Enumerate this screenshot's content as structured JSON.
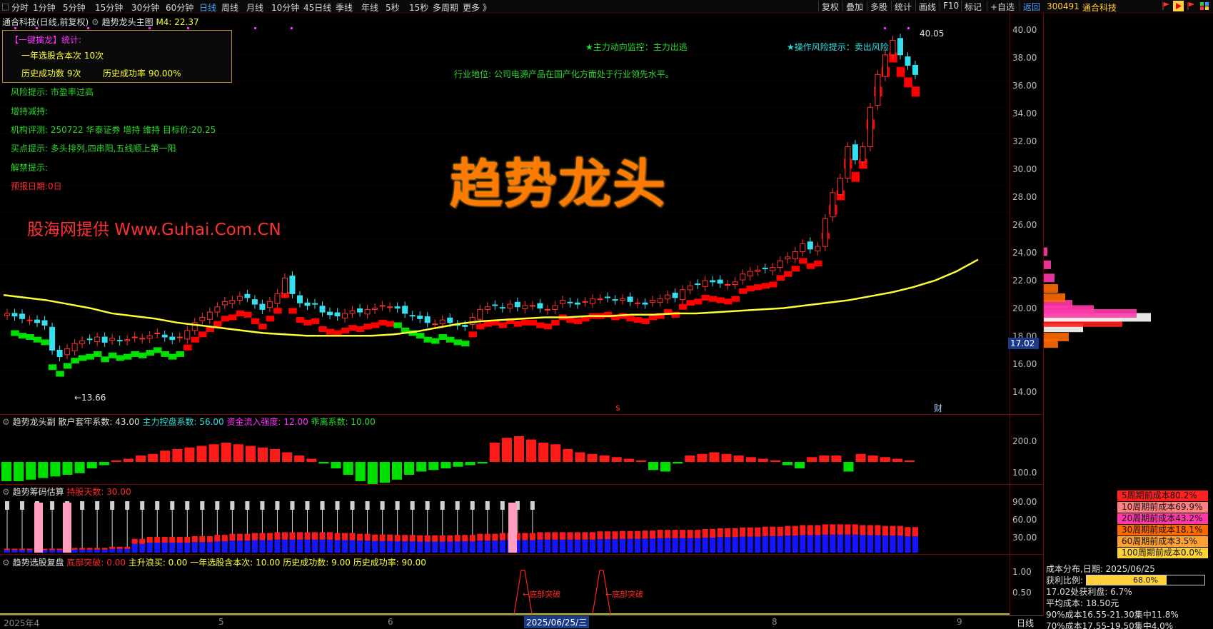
{
  "toolbar": {
    "left": [
      "分时",
      "1分钟",
      "5分钟",
      "15分钟",
      "30分钟",
      "60分钟",
      "日线",
      "周线",
      "月线",
      "10分钟",
      "45日线",
      "季线",
      "年线",
      "5秒",
      "15秒",
      "多周期",
      "更多 》"
    ],
    "active": "日线",
    "right": [
      "复权",
      "叠加",
      "多股",
      "统计",
      "画线",
      "F10",
      "标记",
      "+自选",
      "返回"
    ]
  },
  "stock": {
    "code": "300491",
    "name": "通合科技"
  },
  "main_panel": {
    "title": "通合科技(日线,前复权)",
    "indicator": "趋势龙头主图",
    "m4": "M4: 22.37",
    "big_title": "趋势龙头",
    "watermark": "股海网提供 Www.Guhai.Com.CN",
    "monitor1": "★主力动向监控：主力出逃",
    "monitor2": "★操作风险提示：卖出风险",
    "industry": "行业地位: 公司电源产品在国产化方面处于行业领先水平。",
    "high_label": "40.05",
    "low_label": "←13.66",
    "last_price": "17.02",
    "marker_s": "$",
    "marker_cai": "财"
  },
  "infobox": {
    "title": "【一键擒龙】统计:",
    "line1": "一年选股含本次 10次",
    "line2a": "历史成功数 9次",
    "line2b": "历史成功率 90.00%"
  },
  "notes": [
    {
      "label": "风险提示:",
      "value": "市盈率过高"
    },
    {
      "label": "增持减持:",
      "value": ""
    },
    {
      "label": "机构评测:",
      "value": "250722 华泰证券 增持 维持 目标价:20.25"
    },
    {
      "label": "买点提示:",
      "value": "多头排列,四串阳,五线顺上第一阳"
    },
    {
      "label": "解禁提示:",
      "value": ""
    },
    {
      "label": "预报日期:0日",
      "value": ""
    }
  ],
  "price_axis": [
    "40.00",
    "38.00",
    "36.00",
    "34.00",
    "32.00",
    "30.00",
    "28.00",
    "26.00",
    "24.00",
    "22.00",
    "20.00",
    "18.00",
    "16.00",
    "14.00"
  ],
  "sub1": {
    "title": "趋势龙头副",
    "f1": "散户套牢系数: 43.00",
    "f2": "主力控盘系数: 56.00",
    "f3": "资金流入强度: 12.00",
    "f4": "乖离系数: 10.00",
    "axis": [
      "200.0",
      "100.0"
    ]
  },
  "sub2": {
    "title": "趋势筹码估算",
    "f1": "持股天数: 30.00",
    "axis": [
      "90.00",
      "60.00",
      "30.00"
    ]
  },
  "sub3": {
    "title": "趋势选股复盘",
    "f1": "底部突破: 0.00",
    "f2": "主升浪买: 0.00",
    "f3": "一年选股含本次: 10.00",
    "f4": "历史成功数: 9.00",
    "f5": "历史成功率: 90.00",
    "axis": [
      "1.00",
      "0.50"
    ],
    "ann1": "←底部突破",
    "ann2": "←底部突破"
  },
  "time_axis": {
    "labels": [
      "2025年4",
      "5",
      "6",
      "8",
      "9"
    ],
    "cursor": "2025/06/25/三",
    "period": "日线"
  },
  "cost_table": [
    {
      "label": "5周期前成本80.2%",
      "color": "#ff2020"
    },
    {
      "label": "10周期前成本69.9%",
      "color": "#ff8080"
    },
    {
      "label": "20周期前成本43.2%",
      "color": "#ff3aa8"
    },
    {
      "label": "30周期前成本18.1%",
      "color": "#ff6a00"
    },
    {
      "label": "60周期前成本3.5%",
      "color": "#ffa030"
    },
    {
      "label": "100周期前成本0.0%",
      "color": "#ffd23a"
    }
  ],
  "chip_info": {
    "date": "成本分布,日期: 2025/06/25",
    "profit_label": "获利比例:",
    "profit_value": "68.0%",
    "profit_fraction": 0.68,
    "at_price": "17.02处获利盘: 6.7%",
    "avg": "平均成本: 18.50元",
    "c90": "90%成本16.55-21.30集中11.8%",
    "c70": "70%成本17.55-19.50集中4.0%"
  },
  "chart_data": {
    "type": "candlestick",
    "period": "daily",
    "date_range": [
      "2025-04",
      "2025-09"
    ],
    "ylim": [
      13,
      41
    ],
    "high": 40.05,
    "low": 13.66,
    "last": 17.02,
    "close_series": [
      18.3,
      18.1,
      17.9,
      17.8,
      17.6,
      17.4,
      15.5,
      15.0,
      15.6,
      16.0,
      16.2,
      16.3,
      16.5,
      16.1,
      16.4,
      16.2,
      16.3,
      16.5,
      16.4,
      16.6,
      16.8,
      16.5,
      16.3,
      16.5,
      17.0,
      17.6,
      18.0,
      18.4,
      18.8,
      19.2,
      19.3,
      19.6,
      19.5,
      19.0,
      18.6,
      19.2,
      19.8,
      21.0,
      19.8,
      19.1,
      18.9,
      19.0,
      18.4,
      18.2,
      18.1,
      18.3,
      18.5,
      18.4,
      18.6,
      18.7,
      18.9,
      18.8,
      18.7,
      18.3,
      18.1,
      17.9,
      17.6,
      17.5,
      17.8,
      17.6,
      17.4,
      17.3,
      18.0,
      18.6,
      18.8,
      18.9,
      18.7,
      19.0,
      18.8,
      18.9,
      18.9,
      18.7,
      18.6,
      18.9,
      19.3,
      19.1,
      19.0,
      19.2,
      19.4,
      19.4,
      19.5,
      19.3,
      19.4,
      19.2,
      19.1,
      19.0,
      19.3,
      19.4,
      19.7,
      19.5,
      20.1,
      20.4,
      20.5,
      20.8,
      20.7,
      20.6,
      20.5,
      20.7,
      21.3,
      21.5,
      21.6,
      21.7,
      21.8,
      22.3,
      22.6,
      23.0,
      23.6,
      23.2,
      23.4,
      25.5,
      27.5,
      28.6,
      31.0,
      30.0,
      31.0,
      34.0,
      36.5,
      38.0,
      39.1,
      38.0,
      37.2,
      36.5
    ],
    "ma_yellow": [
      19.7,
      19.5,
      19.3,
      19.0,
      18.7,
      18.3,
      18.1,
      17.9,
      17.6,
      17.4,
      17.2,
      17.0,
      16.8,
      16.7,
      16.6,
      16.6,
      16.6,
      16.6,
      16.7,
      16.9,
      17.2,
      17.5,
      17.7,
      17.8,
      17.9,
      18.0,
      18.0,
      18.1,
      18.1,
      18.2,
      18.2,
      18.3,
      18.3,
      18.4,
      18.5,
      18.6,
      18.7,
      18.9,
      19.1,
      19.3,
      19.6,
      19.9,
      20.3,
      20.8,
      21.5,
      22.4
    ],
    "sub1_hist": [
      -60,
      -60,
      -55,
      -50,
      -45,
      -40,
      -35,
      -20,
      -10,
      5,
      10,
      20,
      25,
      35,
      40,
      45,
      50,
      55,
      60,
      55,
      50,
      45,
      40,
      30,
      20,
      10,
      -5,
      -20,
      -40,
      -60,
      -70,
      -65,
      -55,
      -40,
      -30,
      -25,
      -20,
      -15,
      -10,
      -5,
      60,
      75,
      80,
      70,
      60,
      55,
      40,
      30,
      25,
      20,
      15,
      10,
      5,
      -25,
      -30,
      -5,
      20,
      25,
      30,
      25,
      20,
      15,
      10,
      5,
      -10,
      -20,
      15,
      20,
      20,
      -30,
      25,
      20,
      15,
      10,
      5
    ],
    "sub2_bars": [
      10,
      10,
      10,
      12,
      12,
      15,
      35,
      40,
      40,
      42,
      45,
      48,
      50,
      52,
      52,
      52,
      50,
      48,
      46,
      45,
      44,
      44,
      45,
      48,
      50,
      50,
      52,
      52,
      52,
      54,
      55,
      56,
      58,
      58,
      60,
      62,
      64,
      66,
      68,
      70,
      72,
      72,
      70,
      68,
      65
    ],
    "sub3_peaks": [
      1.0,
      1.0
    ]
  }
}
